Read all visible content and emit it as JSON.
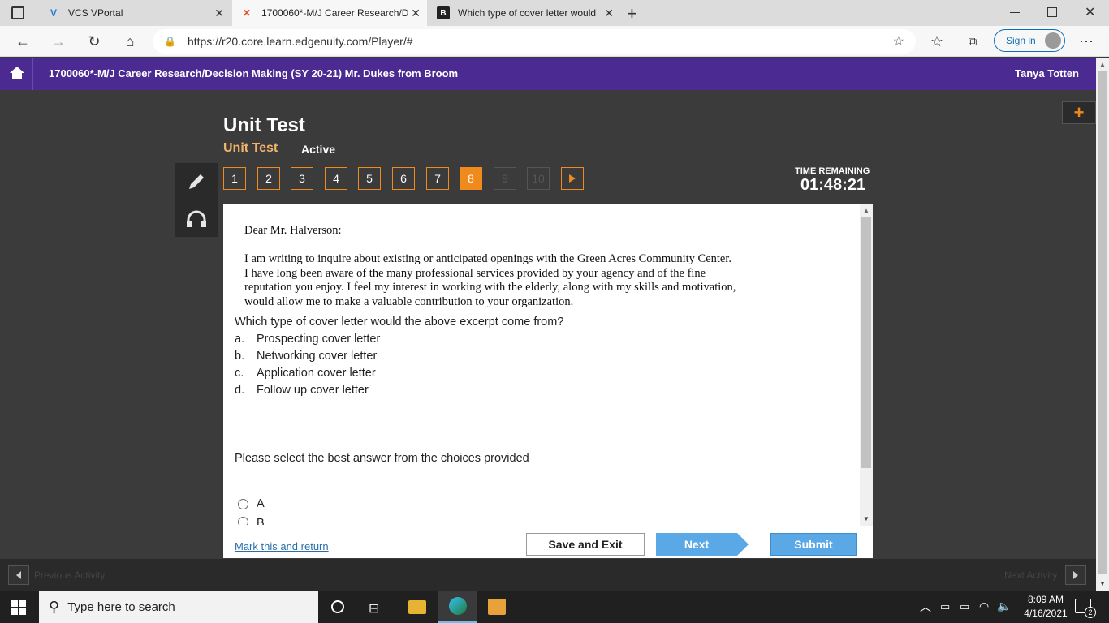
{
  "browser": {
    "tabs": [
      {
        "title": "VCS VPortal",
        "icon": "vportal-icon"
      },
      {
        "title": "1700060*-M/J Career Research/D",
        "icon": "edgenuity-icon"
      },
      {
        "title": "Which type of cover letter would",
        "icon": "brainly-icon"
      }
    ],
    "url": "https://r20.core.learn.edgenuity.com/Player/#",
    "signin_label": "Sign in"
  },
  "course": {
    "title": "1700060*-M/J Career Research/Decision Making (SY 20-21) Mr. Dukes from Broom",
    "user": "Tanya Totten"
  },
  "activity": {
    "heading": "Unit Test",
    "subheading": "Unit Test",
    "status": "Active",
    "questions": [
      "1",
      "2",
      "3",
      "4",
      "5",
      "6",
      "7",
      "8",
      "9",
      "10"
    ],
    "current_question": "8",
    "time_label": "TIME REMAINING",
    "time_value": "01:48:21"
  },
  "question": {
    "letter_salutation": "Dear Mr. Halverson:",
    "letter_lines": [
      "I am writing to inquire about existing or anticipated openings with the Green Acres Community Center.",
      "I have long been aware of the many professional services provided by your agency and of the fine",
      "reputation you enjoy. I feel my interest in working with the elderly, along with my skills and motivation,",
      "would allow me to make a valuable contribution to your organization."
    ],
    "prompt": "Which type of cover letter would the above excerpt come from?",
    "choices": [
      {
        "letter": "a.",
        "text": "Prospecting cover letter"
      },
      {
        "letter": "b.",
        "text": "Networking cover letter"
      },
      {
        "letter": "c.",
        "text": "Application cover letter"
      },
      {
        "letter": "d.",
        "text": "Follow up cover letter"
      }
    ],
    "instruction": "Please select the best answer from the choices provided",
    "radio_options": [
      "A",
      "B"
    ]
  },
  "footer": {
    "mark_link": "Mark this and return",
    "save_exit": "Save and Exit",
    "next": "Next",
    "submit": "Submit"
  },
  "activity_nav": {
    "previous": "Previous Activity",
    "next": "Next Activity"
  },
  "taskbar": {
    "search_placeholder": "Type here to search",
    "time": "8:09 AM",
    "date": "4/16/2021",
    "notifications": "2"
  },
  "colors": {
    "course_header": "#4b2a91",
    "accent_orange": "#f08a1c",
    "button_blue": "#5aa9e6"
  }
}
